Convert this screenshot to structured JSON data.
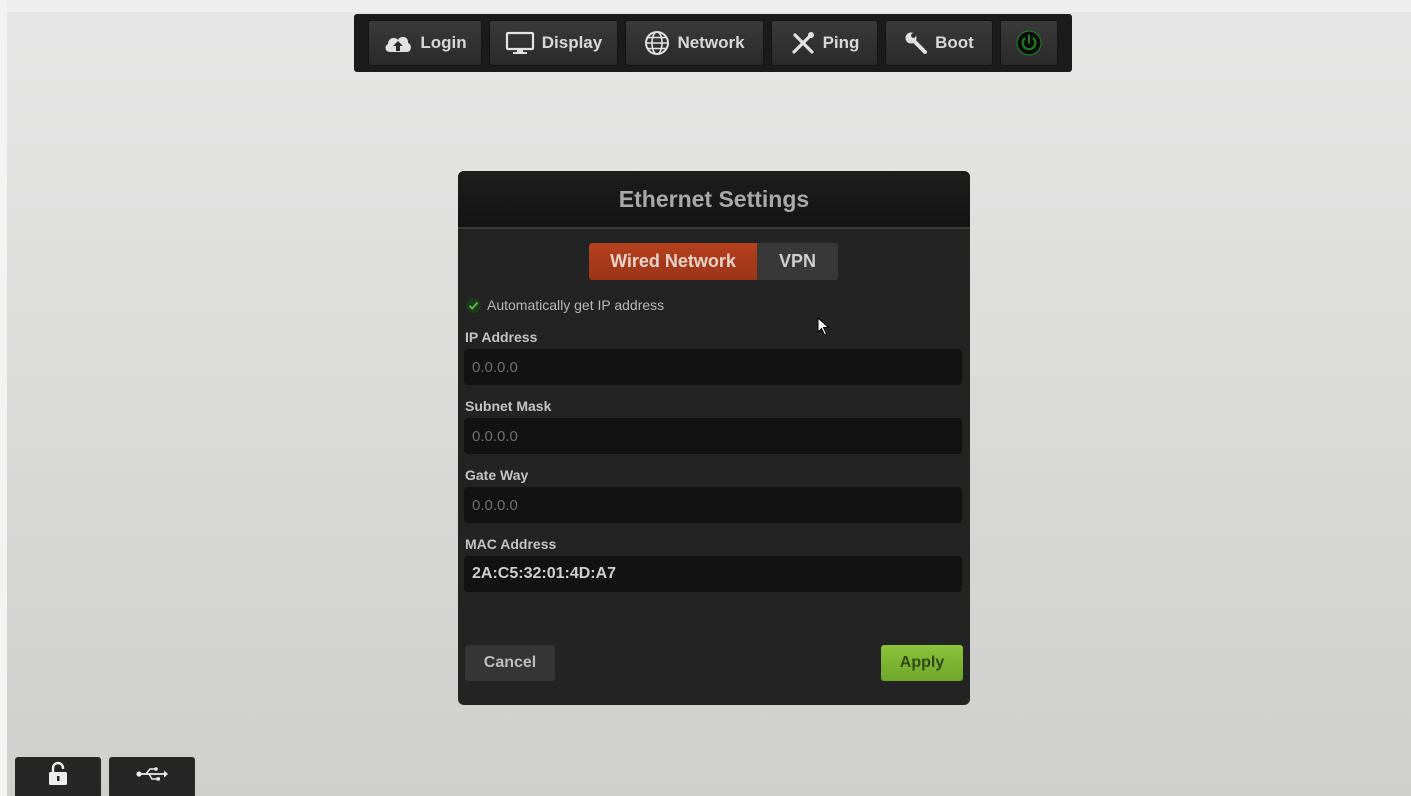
{
  "toolbar": {
    "login_label": "Login",
    "display_label": "Display",
    "network_label": "Network",
    "ping_label": "Ping",
    "boot_label": "Boot"
  },
  "dialog": {
    "title": "Ethernet Settings",
    "tabs": [
      {
        "label": "Wired Network",
        "active": true
      },
      {
        "label": "VPN",
        "active": false
      }
    ],
    "auto_ip": {
      "label": "Automatically get IP address",
      "checked": true
    },
    "fields": [
      {
        "label": "IP Address",
        "value": "0.0.0.0"
      },
      {
        "label": "Subnet Mask",
        "value": "0.0.0.0"
      },
      {
        "label": "Gate Way",
        "value": "0.0.0.0"
      },
      {
        "label": "MAC Address",
        "value": "2A:C5:32:01:4D:A7"
      }
    ],
    "cancel_label": "Cancel",
    "apply_label": "Apply"
  },
  "icons": {
    "login": "cloud-upload-icon",
    "display": "monitor-icon",
    "network": "globe-icon",
    "ping": "tools-icon",
    "boot": "wrench-icon",
    "power": "power-icon",
    "lock": "unlock-icon",
    "usb": "usb-icon"
  },
  "colors": {
    "active_tab": "#b5401e",
    "apply": "#8cc33a",
    "power": "#1f7a1f"
  }
}
